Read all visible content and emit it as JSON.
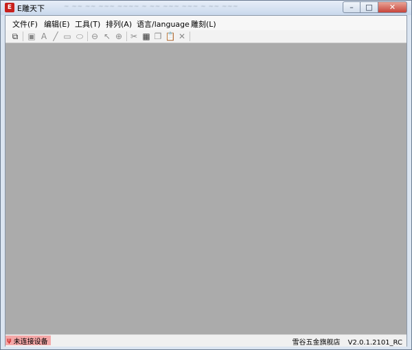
{
  "window": {
    "app_icon_text": "E",
    "title": "E雕天下",
    "faded_title": "~ ~~ ~~ ~~~ ~~~~ ~ ~~ ~~~ ~~~ ~ ~~ ~~~",
    "minimize_glyph": "–",
    "maximize_glyph": "□",
    "close_glyph": "✕"
  },
  "menu": {
    "items": [
      {
        "label": "文件(F)"
      },
      {
        "label": "编辑(E)"
      },
      {
        "label": "工具(T)"
      },
      {
        "label": "排列(A)"
      },
      {
        "label": "语言/language"
      },
      {
        "label": "雕刻(L)"
      }
    ]
  },
  "toolbar": {
    "tools": [
      {
        "icon": "new-document-icon",
        "glyph": "⧉"
      },
      {
        "icon": "image-icon",
        "glyph": "▣"
      },
      {
        "icon": "text-icon",
        "glyph": "A"
      },
      {
        "icon": "line-icon",
        "glyph": "╱"
      },
      {
        "icon": "rectangle-icon",
        "glyph": "▭"
      },
      {
        "icon": "ellipse-icon",
        "glyph": "⬭"
      },
      {
        "icon": "zoom-out-icon",
        "glyph": "⊖"
      },
      {
        "icon": "pointer-icon",
        "glyph": "↖"
      },
      {
        "icon": "zoom-in-icon",
        "glyph": "⊕"
      },
      {
        "icon": "cut-icon",
        "glyph": "✂"
      },
      {
        "icon": "grid-icon",
        "glyph": "▦"
      },
      {
        "icon": "copy-icon",
        "glyph": "❐"
      },
      {
        "icon": "paste-icon",
        "glyph": "📋"
      },
      {
        "icon": "delete-icon",
        "glyph": "✕"
      }
    ]
  },
  "status": {
    "connection": "未连接设备",
    "shop": "雪谷五金旗舰店",
    "version": "V2.0.1.2101_RC"
  },
  "colors": {
    "canvas": "#ababab",
    "status_warning": "#f4a7a7"
  }
}
